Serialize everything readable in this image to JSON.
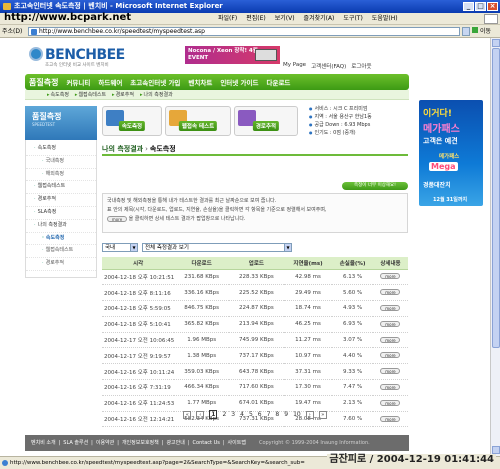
{
  "window": {
    "title": "초고속인터넷 속도측정 | 벤치비 - Microsoft Internet Explorer",
    "buttons": [
      "_",
      "□",
      "×"
    ]
  },
  "watermark": "http://www.bcpark.net",
  "menubar": [
    "파일(F)",
    "편집(E)",
    "보기(V)",
    "즐겨찾기(A)",
    "도구(T)",
    "도움말(H)"
  ],
  "address": {
    "label": "주소(D)",
    "url": "http://www.benchbee.co.kr/speedtest/myspeedtest.asp",
    "go_label": "이동"
  },
  "site": {
    "logo_text": "BENCHBEE",
    "logo_sub": "초고속 인터넷 비교 사이트 벤치비",
    "banner_text": "Nocona / Xeon 장착! 4월 EVENT",
    "toplinks": [
      "My Page",
      "고객센터(FAQ)",
      "로그아웃"
    ],
    "nav": [
      "품질측정",
      "커뮤니티",
      "하드웨어",
      "초고속인터넷 가입",
      "벤치차트",
      "인터넷 가이드",
      "다운로드"
    ],
    "subnav": [
      "속도측정",
      "웹접속테스트",
      "경로추적",
      "나의 측정결과"
    ]
  },
  "sidebar": {
    "title": "품질측정",
    "subtitle": "SPEEDTEST",
    "items": [
      {
        "label": "속도측정",
        "sub": false
      },
      {
        "label": "국내측정",
        "sub": true
      },
      {
        "label": "해외측정",
        "sub": true
      },
      {
        "label": "웹접속테스트",
        "sub": false
      },
      {
        "label": "경로추적",
        "sub": false
      },
      {
        "label": "SLA측정",
        "sub": false
      },
      {
        "label": "나의 측정결과",
        "sub": false
      },
      {
        "label": "속도측정",
        "sub": true
      },
      {
        "label": "웹접속테스트",
        "sub": true
      },
      {
        "label": "경로추적",
        "sub": true
      }
    ]
  },
  "cards": [
    {
      "label": "속도측정",
      "color": "#3e7fc4"
    },
    {
      "label": "웹접속 테스트",
      "color": "#e6a73a"
    },
    {
      "label": "경로추적",
      "color": "#8a5ac0"
    }
  ],
  "info": [
    "서비스 : 시크 C 프리미엄",
    "지역 : 서울 용산구 한남1동",
    "공급 Down : 6.93 Mbps",
    "인기도 : 0점 (중개)"
  ],
  "breadcrumb": {
    "title": "나의 측정결과",
    "arrow": "›",
    "current": "속도측정"
  },
  "faq_button": "측정이 너무 이상해요!",
  "description": {
    "line1": "국내측정 및 해외측정을 통해 내가 테스트한 결과를 최근 날짜순으로 보여 줍니다.",
    "line2a": "표 안의 제목(시각, 다운로드, 업로드, 지연율, 손실율)을 클릭하면 각 항목을 기준으로 정렬해서 보여주며,",
    "line3a": "",
    "more": "more",
    "line3b": "을 클릭하면 상세 테스트 결과가 팝업창으로 나타납니다."
  },
  "filters": {
    "region": "국내",
    "period": "전체 측정결과 보기"
  },
  "table": {
    "columns": [
      "시각",
      "다운로드",
      "업로드",
      "지연율(ms)",
      "손실율(%)",
      "상세내용"
    ],
    "more_label": "more",
    "rows": [
      [
        "2004-12-18 오후 10:21:51",
        "231.68 KBps",
        "228.33 KBps",
        "42.98 ms",
        "6.13 %"
      ],
      [
        "2004-12-18 오후 8:11:16",
        "336.16 KBps",
        "225.52 KBps",
        "29.49 ms",
        "5.60 %"
      ],
      [
        "2004-12-18 오후 5:59:05",
        "846.75 KBps",
        "224.87 KBps",
        "18.74 ms",
        "4.93 %"
      ],
      [
        "2004-12-18 오후 5:10:41",
        "365.82 KBps",
        "213.94 KBps",
        "46.25 ms",
        "6.93 %"
      ],
      [
        "2004-12-17 오전 10:06:45",
        "1.96 MBps",
        "745.99 KBps",
        "11.27 ms",
        "3.07 %"
      ],
      [
        "2004-12-17 오전 9:19:57",
        "1.38 MBps",
        "737.17 KBps",
        "10.97 ms",
        "4.40 %"
      ],
      [
        "2004-12-16 오후 10:11:24",
        "359.03 KBps",
        "643.78 KBps",
        "37.31 ms",
        "9.33 %"
      ],
      [
        "2004-12-16 오후 7:31:19",
        "466.34 KBps",
        "717.60 KBps",
        "17.30 ms",
        "7.47 %"
      ],
      [
        "2004-12-16 오후 11:24:53",
        "1.77 MBps",
        "674.01 KBps",
        "19.47 ms",
        "2.13 %"
      ],
      [
        "2004-12-16 오전 12:14:21",
        "582.34 KBps",
        "737.31 KBps",
        "28.08 ms",
        "7.60 %"
      ]
    ]
  },
  "pager": {
    "first": "«",
    "prev": "‹",
    "pages": [
      "1",
      "2",
      "3",
      "4",
      "5",
      "6",
      "7",
      "8",
      "9",
      "10"
    ],
    "current": "1",
    "next": "›",
    "last": "»"
  },
  "footer": [
    "벤치비 소개",
    "SLA 솔루션",
    "이용약관",
    "개인정보보호정책",
    "광고안내",
    "Contact Us",
    "사이트맵"
  ],
  "footer_copy": "Copyright © 1999-2004 Inaung Information.",
  "ad": {
    "l1": "이거다!",
    "l2": "메가패스",
    "l3": "고객은 예견",
    "l4": "메가패스",
    "l5": "Mega",
    "l6": "경품대잔치",
    "l7": "12월 31일까지"
  },
  "status": {
    "url": "http://www.benchbee.co.kr/speedtest/myspeedtest.asp?page=2&SearchType=&SearchKey=&search_sub=",
    "caption": "금잔피로 / 2004-12-19 01:41:44"
  }
}
